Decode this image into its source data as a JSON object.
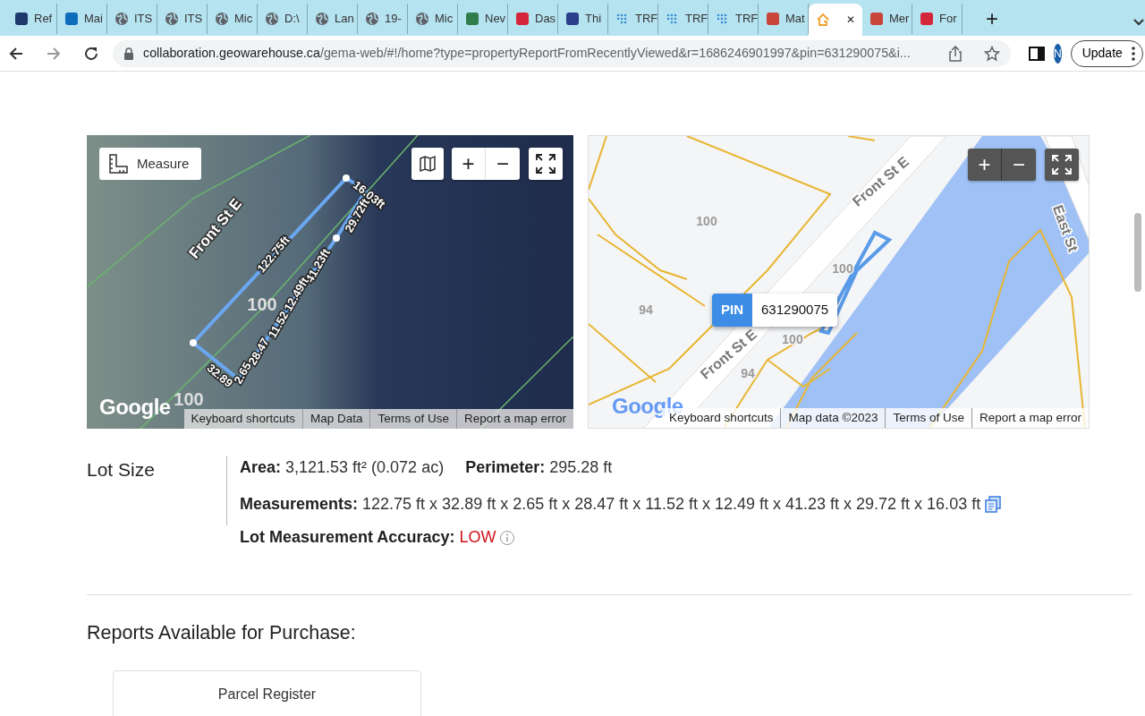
{
  "browser": {
    "tabs": [
      {
        "title": "Ref",
        "kind": "app",
        "color": "#1d3a6b",
        "selected": false
      },
      {
        "title": "Mai",
        "kind": "app",
        "color": "#0f6cbd",
        "selected": false
      },
      {
        "title": "ITS",
        "kind": "globe",
        "selected": false
      },
      {
        "title": "ITS",
        "kind": "globe",
        "selected": false
      },
      {
        "title": "Mic",
        "kind": "globe",
        "selected": false
      },
      {
        "title": "D:\\",
        "kind": "globe",
        "selected": false
      },
      {
        "title": "Lan",
        "kind": "globe",
        "selected": false
      },
      {
        "title": "19-",
        "kind": "globe",
        "selected": false
      },
      {
        "title": "Mic",
        "kind": "globe",
        "selected": false
      },
      {
        "title": "Nev",
        "kind": "app",
        "color": "#2f7d4a",
        "selected": false
      },
      {
        "title": "Das",
        "kind": "app",
        "color": "#d3263a",
        "selected": false
      },
      {
        "title": "Thi",
        "kind": "app",
        "color": "#2c3e8c",
        "selected": false
      },
      {
        "title": "TRF",
        "kind": "dots",
        "color": "#3a8fd6",
        "selected": false
      },
      {
        "title": "TRF",
        "kind": "dots",
        "color": "#3a8fd6",
        "selected": false
      },
      {
        "title": "TRF",
        "kind": "dots",
        "color": "#3a8fd6",
        "selected": false
      },
      {
        "title": "Mat",
        "kind": "app",
        "color": "#c8453a",
        "selected": false
      },
      {
        "kind": "house",
        "color": "#f0a030",
        "selected": true,
        "close": "✕"
      },
      {
        "title": "Mer",
        "kind": "app",
        "color": "#c8453a",
        "selected": false
      },
      {
        "title": "For",
        "kind": "app",
        "color": "#d3263a",
        "selected": false
      }
    ],
    "new_tab": "+",
    "url_host": "collaboration.geowarehouse.ca",
    "url_path": "/gema-web/#!/home?type=propertyReportFromRecentlyViewed&r=1686246901997&pin=631290075&i...",
    "profile": "N",
    "update_button": "Update"
  },
  "satellite_map": {
    "measure_button": "Measure",
    "zoom_in": "+",
    "zoom_out": "−",
    "labels": [
      "Front St E",
      "122.75ft",
      "16.03ft",
      "29.72ft",
      "41.23ft",
      "12.49ft",
      "11.52",
      "28.47",
      "2.65",
      "32.89",
      "100",
      "100"
    ],
    "logo": "Google",
    "footer_links": [
      "Keyboard shortcuts",
      "Map Data",
      "Terms of Use",
      "Report a map error"
    ]
  },
  "road_map": {
    "zoom_in": "+",
    "zoom_out": "−",
    "labels": [
      "Front St E",
      "Front St E",
      "East St",
      "100",
      "94",
      "100",
      "100",
      "94"
    ],
    "pin_tag": "PIN",
    "pin_value": "631290075",
    "logo": "Google",
    "footer_links": [
      "Keyboard shortcuts",
      "Map data ©2023",
      "Terms of Use",
      "Report a map error"
    ]
  },
  "lot_size": {
    "heading": "Lot Size",
    "area_label": "Area:",
    "area_value": "3,121.53 ft² (0.072 ac)",
    "perimeter_label": "Perimeter:",
    "perimeter_value": "295.28 ft",
    "measurements_label": "Measurements:",
    "measurements_value": "122.75 ft x 32.89 ft x 2.65 ft x 28.47 ft x 11.52 ft x 12.49 ft x 41.23 ft x 29.72 ft x 16.03 ft",
    "accuracy_label": "Lot Measurement Accuracy:",
    "accuracy_value": "LOW"
  },
  "reports": {
    "heading": "Reports Available for Purchase:",
    "cards": [
      "Parcel Register"
    ]
  }
}
